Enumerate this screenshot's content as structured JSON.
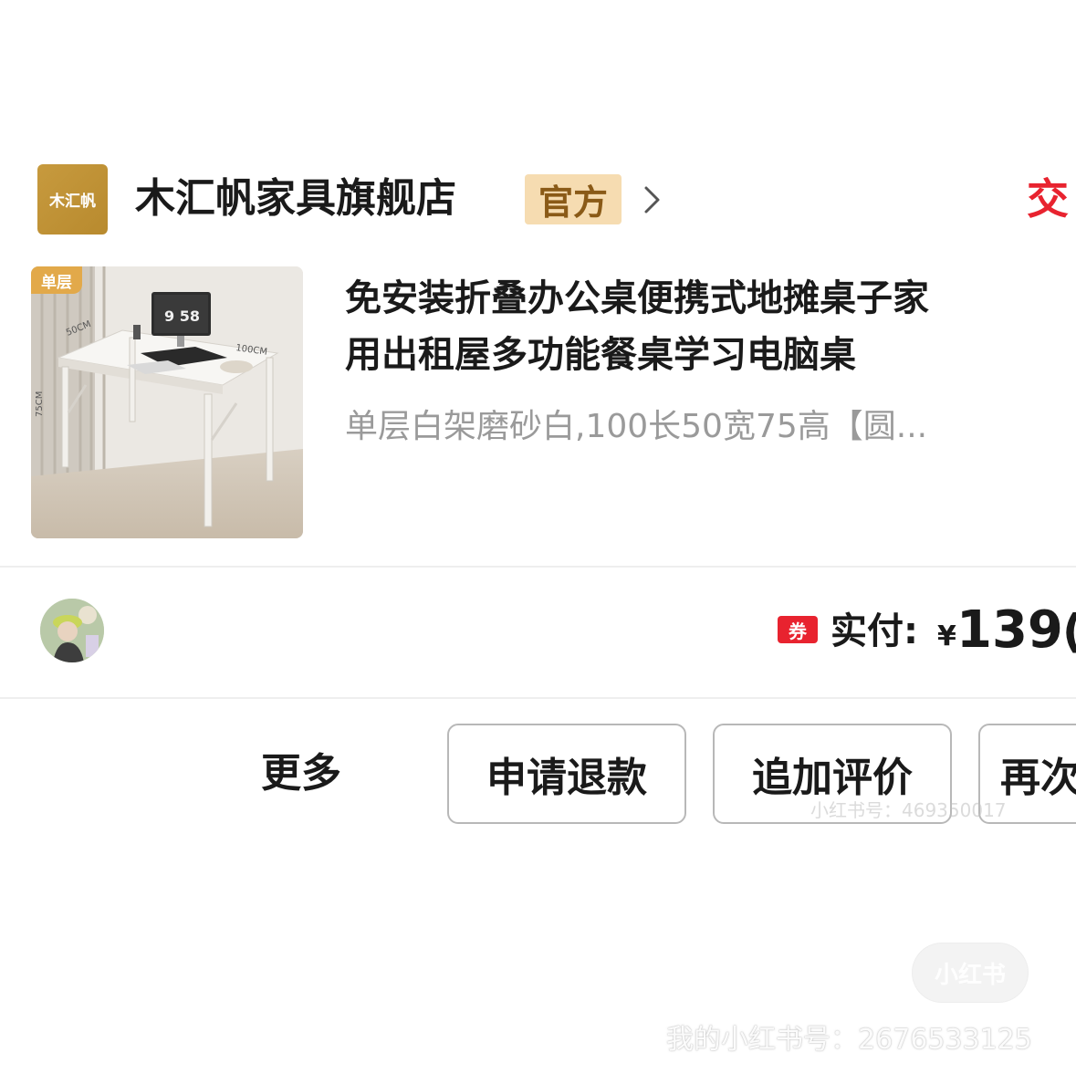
{
  "store": {
    "logo_text": "木汇帆",
    "name": "木汇帆家具旗舰店",
    "badge": "官方",
    "status": "交"
  },
  "product": {
    "thumb_tag": "单层",
    "thumb_labels": {
      "depth": "50CM",
      "width": "100CM",
      "height": "75CM",
      "clock": "9 58"
    },
    "title_line1": "免安装折叠办公桌便携式地摊桌子家",
    "title_line2": "用出租屋多功能餐桌学习电脑桌",
    "spec": "单层白架磨砂白,100长50宽75高【圆..."
  },
  "payment": {
    "coupon_label": "券",
    "paid_label": "实付:",
    "currency": "¥",
    "amount": "139",
    "trailing": "("
  },
  "actions": {
    "more": "更多",
    "refund": "申请退款",
    "review": "追加评价",
    "rebuy": "再次"
  },
  "watermarks": {
    "small": "小红书号：469350017",
    "logo": "小红书",
    "id_line": "我的小红书号：2676533125"
  },
  "colors": {
    "accent_red": "#e8232f",
    "badge_bg": "#f6dcb1",
    "logo_gold": "#c79a3e",
    "muted_text": "#9a9a9a"
  }
}
